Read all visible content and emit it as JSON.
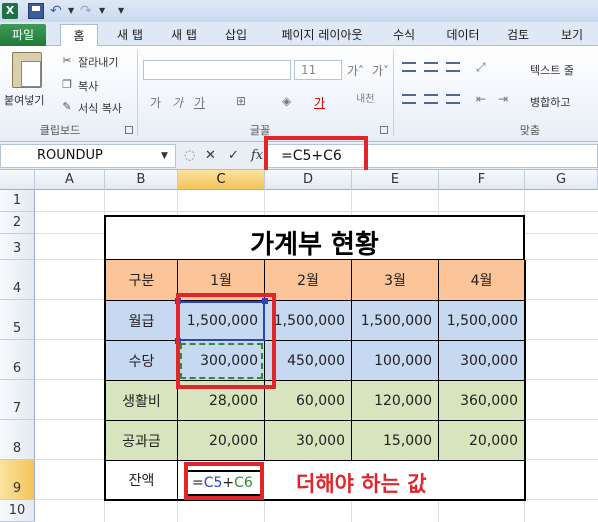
{
  "quick_access": {
    "app_icon": "excel-logo",
    "icons": [
      "save-icon",
      "undo-icon",
      "redo-icon"
    ]
  },
  "tabs": [
    "파일",
    "홈",
    "새 탭",
    "새 탭",
    "삽입",
    "페이지 레이아웃",
    "수식",
    "데이터",
    "검토",
    "보기"
  ],
  "ribbon": {
    "clipboard": {
      "paste": "붙여넣기",
      "cut": "잘라내기",
      "copy": "복사",
      "format_painter": "서식 복사",
      "group": "클립보드"
    },
    "font": {
      "size": "11",
      "group": "글꼴"
    },
    "alignment": {
      "wrap_text": "텍스트 줄",
      "merge": "병합하고",
      "group": "맞춤"
    }
  },
  "formula_bar": {
    "name_box": "ROUNDUP",
    "formula": "=C5+C6",
    "fx": "fx"
  },
  "columns": [
    "A",
    "B",
    "C",
    "D",
    "E",
    "F",
    "G"
  ],
  "rows": [
    "1",
    "2",
    "3",
    "4",
    "5",
    "6",
    "7",
    "8",
    "9",
    "10"
  ],
  "sheet": {
    "title": "가계부 현황",
    "header": [
      "구분",
      "1월",
      "2월",
      "3월",
      "4월"
    ],
    "data_rows": [
      {
        "label": "월급",
        "values": [
          "1,500,000",
          "1,500,000",
          "1,500,000",
          "1,500,000"
        ]
      },
      {
        "label": "수당",
        "values": [
          "300,000",
          "450,000",
          "100,000",
          "300,000"
        ]
      },
      {
        "label": "생활비",
        "values": [
          "28,000",
          "60,000",
          "120,000",
          "360,000"
        ]
      },
      {
        "label": "공과금",
        "values": [
          "20,000",
          "30,000",
          "15,000",
          "20,000"
        ]
      }
    ],
    "balance_label": "잔액",
    "editing_formula": {
      "prefix": "=",
      "ref1": "C5",
      "plus": "+",
      "ref2": "C6"
    }
  },
  "annotation": "더해야 하는 값",
  "colors": {
    "accent_red": "#e0262a",
    "header_fill": "#fbc499",
    "blue_fill": "#c6d9f1",
    "green_fill": "#d7e4bd",
    "ref1_color": "#2b46b8",
    "ref2_color": "#2e8b2e"
  }
}
